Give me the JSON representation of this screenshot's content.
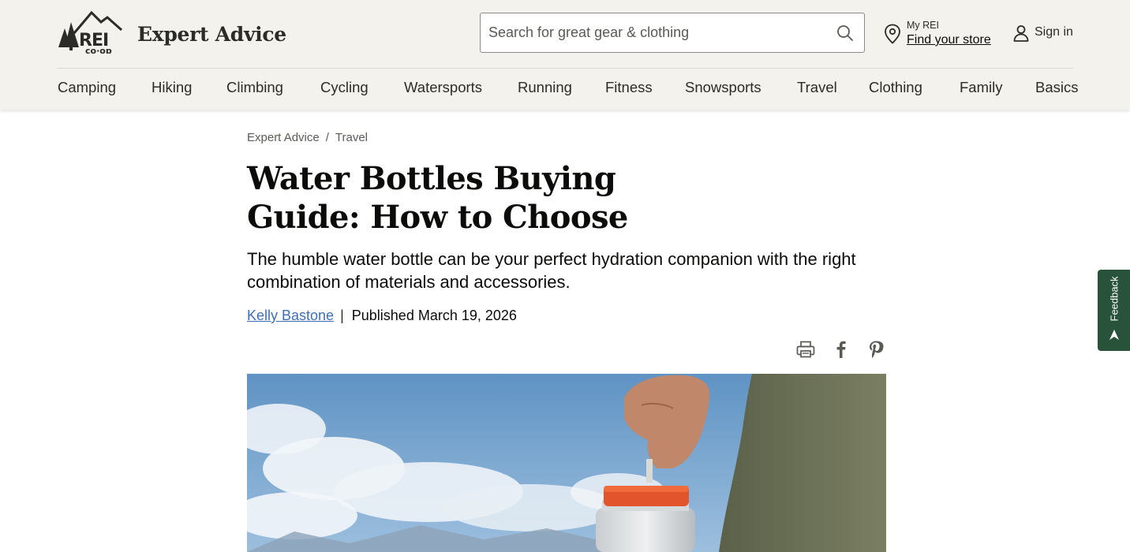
{
  "header": {
    "logo_text": "REI co-op",
    "brand": "Expert Advice",
    "search": {
      "placeholder": "Search for great gear & clothing"
    },
    "my_rei": {
      "label": "My REI",
      "link": "Find your store"
    },
    "sign_in": "Sign in"
  },
  "nav": {
    "items": [
      "Camping",
      "Hiking",
      "Climbing",
      "Cycling",
      "Watersports",
      "Running",
      "Fitness",
      "Snowsports",
      "Travel",
      "Clothing",
      "Family",
      "Basics"
    ]
  },
  "article": {
    "breadcrumb": [
      "Expert Advice",
      "Travel"
    ],
    "breadcrumb_separator": "/",
    "title": "Water Bottles Buying Guide: How to Choose",
    "subtitle": "The humble water bottle can be your perfect hydration companion with the right combination of materials and accessories.",
    "author": "Kelly Bastone",
    "byline_separator": "|",
    "published": "Published March 19, 2026",
    "share_icons": [
      "print-icon",
      "facebook-icon",
      "pinterest-icon"
    ]
  },
  "feedback": {
    "label": "Feedback"
  },
  "colors": {
    "header_bg": "#f4f2ed",
    "link": "#406eb5",
    "feedback_bg": "#29523b",
    "text": "#0b0b09"
  }
}
